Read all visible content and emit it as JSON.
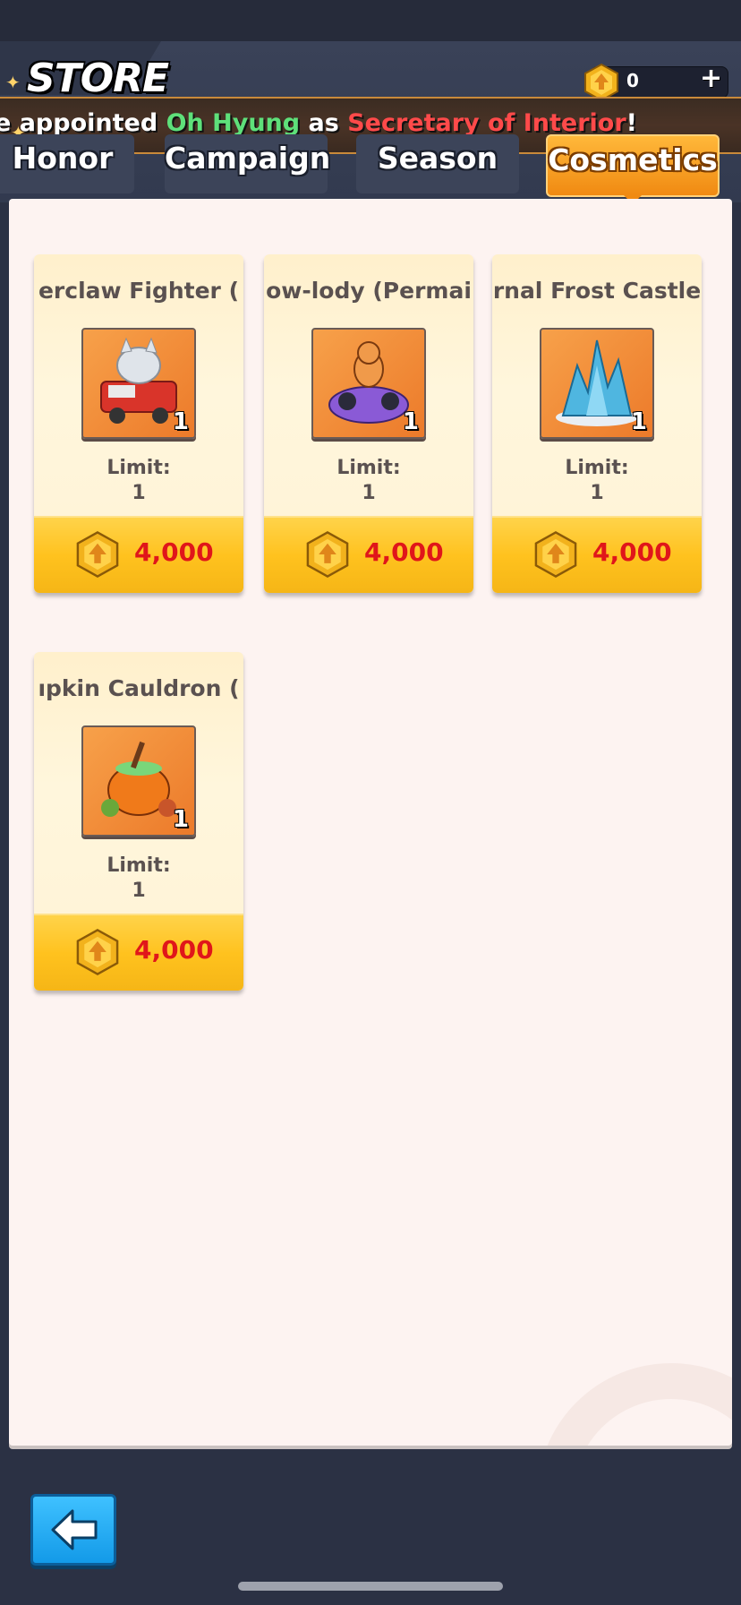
{
  "header": {
    "title": "STORE",
    "currency_value": "0",
    "currency_plus": "+"
  },
  "banner": {
    "prefix": "e appointed ",
    "name": "Oh Hyung",
    "middle": " as ",
    "position": "Secretary of Interior",
    "suffix": "!"
  },
  "tabs": [
    {
      "label": "Honor",
      "active": false
    },
    {
      "label": "Campaign",
      "active": false
    },
    {
      "label": "Season",
      "active": false
    },
    {
      "label": "Cosmetics",
      "active": true
    }
  ],
  "items": [
    {
      "name": "erclaw Fighter (",
      "qty": "1",
      "limit_label": "Limit:",
      "limit_value": "1",
      "price": "4,000",
      "icon": "fire-truck-cat-icon"
    },
    {
      "name": "ow-lody (Permai",
      "qty": "1",
      "limit_label": "Limit:",
      "limit_value": "1",
      "price": "4,000",
      "icon": "dj-cat-icon"
    },
    {
      "name": "rnal Frost Castle",
      "qty": "1",
      "limit_label": "Limit:",
      "limit_value": "1",
      "price": "4,000",
      "icon": "frost-castle-icon"
    },
    {
      "name": "ıpkin Cauldron (",
      "qty": "1",
      "limit_label": "Limit:",
      "limit_value": "1",
      "price": "4,000",
      "icon": "pumpkin-cauldron-icon"
    }
  ],
  "colors": {
    "background": "#2b3144",
    "panel": "#fdf3f1",
    "tab_active": "#f08a12",
    "price": "#e0161a",
    "banner_name": "#5ee07a",
    "banner_position": "#ff4a4a",
    "back_button": "#139ae8"
  }
}
